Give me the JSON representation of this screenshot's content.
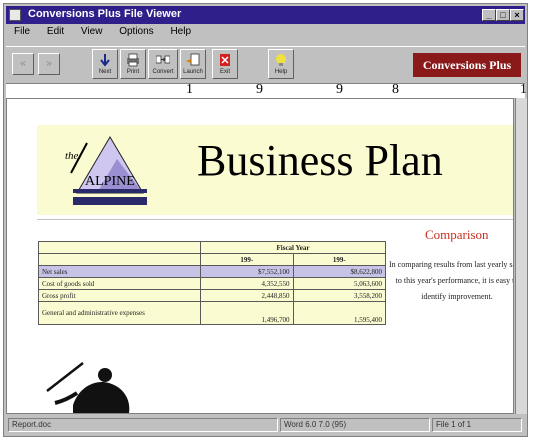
{
  "window": {
    "title": "Conversions Plus File Viewer",
    "controls": [
      "_",
      "□",
      "×"
    ]
  },
  "menu": [
    "File",
    "Edit",
    "View",
    "Options",
    "Help"
  ],
  "toolbar": {
    "nav": [
      "«",
      "»"
    ],
    "buttons": [
      "Next",
      "Print",
      "Convert",
      "Launch",
      "Exit",
      "Help"
    ],
    "brand": "Conversions Plus"
  },
  "ruler_marks": [
    "1",
    "9",
    "9",
    "8",
    "1"
  ],
  "document": {
    "heading": "Business Plan",
    "logo_text": "ALPINE",
    "logo_script": "the",
    "comparison_title": "Comparison",
    "comparison_text": "In comparing results from last yearly sales to this year's performance, it is easy to identify improvement.",
    "table": {
      "group_header": "Fiscal Year",
      "year_headers": [
        "199-",
        "199-"
      ],
      "rows": [
        {
          "label": "Net sales",
          "v1": "$7,552,100",
          "v2": "$8,622,800",
          "highlight": true
        },
        {
          "label": "Cost of goods sold",
          "v1": "4,352,550",
          "v2": "5,063,600",
          "highlight": false
        },
        {
          "label": "Gross profit",
          "v1": "2,448,850",
          "v2": "3,558,200",
          "highlight": false
        },
        {
          "label": "General and administrative expenses",
          "v1": "1,496,700",
          "v2": "1,595,400",
          "highlight": false
        }
      ]
    }
  },
  "status": {
    "file": "Report.doc",
    "format": "Word 6.0 7.0 (95)",
    "page": "File 1 of 1"
  },
  "colors": {
    "titlebar": "#2e1f8a",
    "brand": "#8a1a1a",
    "banner": "#fbfbd2",
    "row_highlight": "#c6c3e6",
    "comparison_title": "#c43020"
  }
}
